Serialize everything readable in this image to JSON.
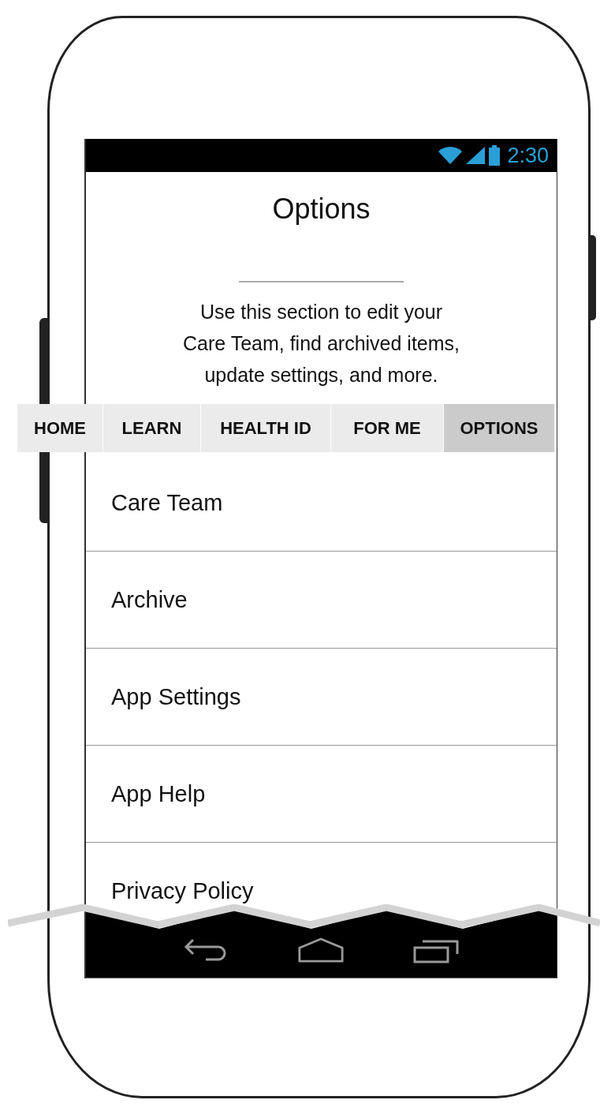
{
  "status_bar": {
    "time": "2:30"
  },
  "header": {
    "title": "Options",
    "description_lines": [
      "Use this section to edit your",
      "Care Team, find archived items,",
      "update settings, and more."
    ]
  },
  "tabs": [
    {
      "label": "HOME",
      "selected": false
    },
    {
      "label": "LEARN",
      "selected": false
    },
    {
      "label": "HEALTH ID",
      "selected": false
    },
    {
      "label": "FOR ME",
      "selected": false
    },
    {
      "label": "OPTIONS",
      "selected": true
    }
  ],
  "menu_items": [
    {
      "label": "Care Team"
    },
    {
      "label": "Archive"
    },
    {
      "label": "App Settings"
    },
    {
      "label": "App Help"
    },
    {
      "label": "Privacy Policy"
    }
  ]
}
